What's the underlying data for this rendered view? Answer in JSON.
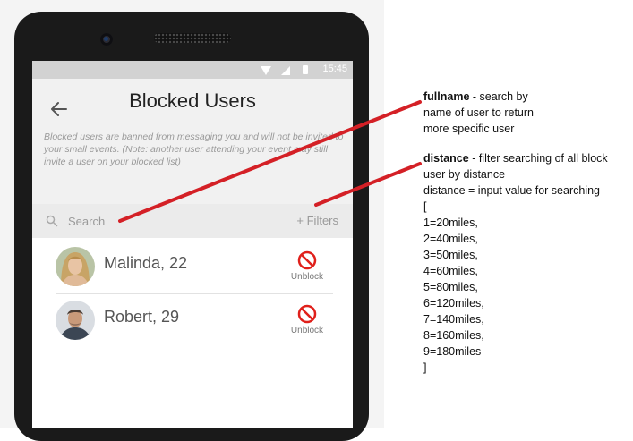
{
  "status_bar": {
    "time": "15:45"
  },
  "header": {
    "title": "Blocked Users",
    "description": "Blocked users are banned from messaging you and will not be invited to your small events. (Note: another user attending your event may still invite a user on your blocked list)"
  },
  "search": {
    "placeholder": "Search",
    "filters_label": "+ Filters"
  },
  "blocked_users": [
    {
      "name": "Malinda, 22",
      "action": "Unblock"
    },
    {
      "name": "Robert, 29",
      "action": "Unblock"
    }
  ],
  "annotations": {
    "fullname": {
      "key": "fullname",
      "lines": [
        " - search by",
        "name of user to return",
        "more specific user"
      ]
    },
    "distance": {
      "key": "distance",
      "lines": [
        " - filter searching of all block",
        "user by distance",
        "distance = input value for searching",
        "[",
        "1=20miles,",
        "2=40miles,",
        "3=50miles,",
        "4=60miles,",
        "5=80miles,",
        "6=120miles,",
        "7=140miles,",
        "8=160miles,",
        "9=180miles",
        "]"
      ]
    }
  },
  "colors": {
    "block_icon": "#e0201b",
    "annotation_line": "#d42026",
    "status_bar": "#d2d2d2",
    "phone_body": "#1a1a1a"
  }
}
